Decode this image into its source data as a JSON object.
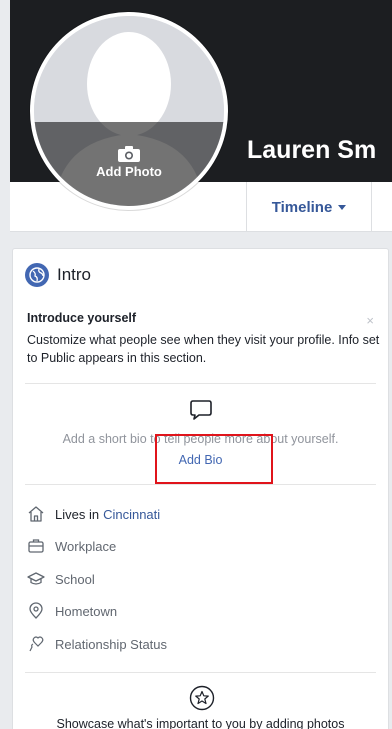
{
  "profile": {
    "name": "Lauren Sm",
    "avatar_action": "Add Photo",
    "tab_timeline": "Timeline"
  },
  "intro": {
    "title": "Intro",
    "introduce_heading": "Introduce yourself",
    "close_glyph": "×",
    "description": "Customize what people see when they visit your profile. Info set to Public appears in this section.",
    "bio_prompt": "Add a short bio to tell people more about yourself.",
    "add_bio": "Add Bio",
    "details": {
      "lives_prefix": "Lives in",
      "lives_city": "Cincinnati",
      "workplace": "Workplace",
      "school": "School",
      "hometown": "Hometown",
      "relationship": "Relationship Status"
    },
    "showcase": "Showcase what's important to you by adding photos"
  },
  "colors": {
    "link": "#365899",
    "brand": "#4267b2",
    "highlight": "#e0141b"
  }
}
